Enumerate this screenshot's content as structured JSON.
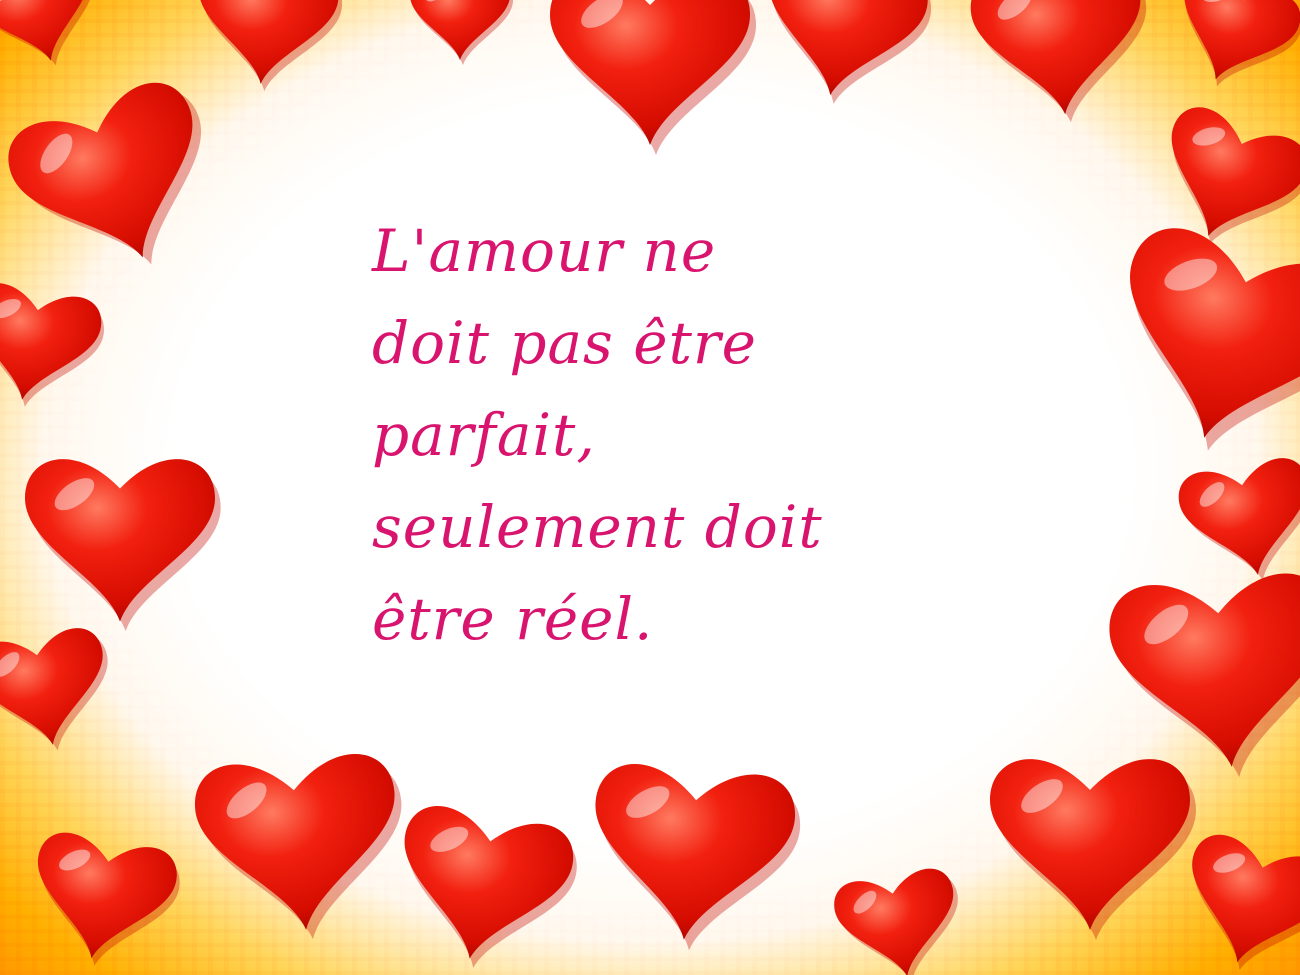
{
  "quote": {
    "lines": [
      "L'amour ne",
      "doit pas être",
      "parfait,",
      "seulement doit",
      "être réel."
    ]
  },
  "colors": {
    "text": "#d8146e",
    "heart": "#ee1a10",
    "heart_dark": "#b80800",
    "heart_highlight": "#ffb0a0",
    "frame_glow": "#ffb000"
  },
  "decoration": {
    "motif": "heart-icon frame"
  }
}
